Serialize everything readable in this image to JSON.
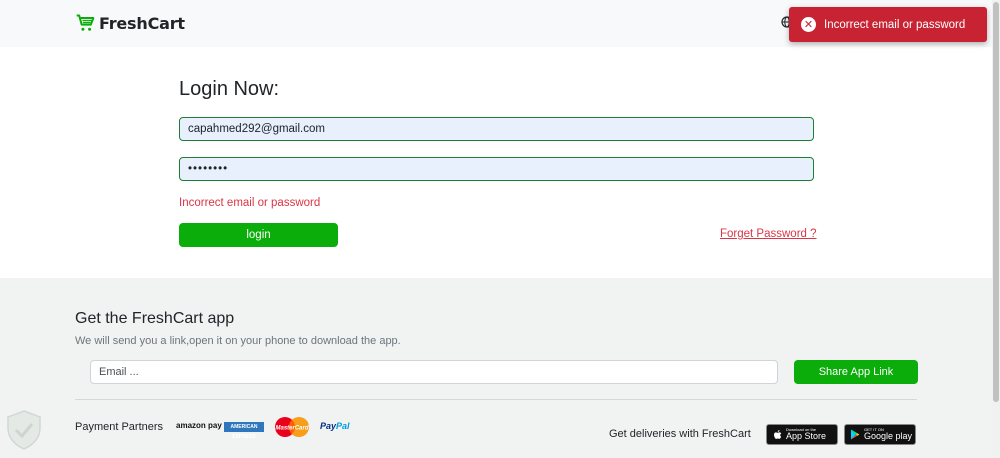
{
  "navbar": {
    "brand": "FreshCart",
    "brand_icon": "cart-icon",
    "language_icon": "globe-icon"
  },
  "toast": {
    "icon": "error-circle-icon",
    "icon_glyph": "✕",
    "message": "Incorrect email or password",
    "color": "#c82333"
  },
  "login": {
    "title": "Login Now:",
    "email_value": "capahmed292@gmail.com",
    "password_value": "••••••••",
    "error": "Incorrect email or password",
    "submit_label": "login",
    "forget_label": "Forget Password ?"
  },
  "footer": {
    "title": "Get the FreshCart app",
    "subtitle": "We will send you a link,open it on your phone to download the app.",
    "email_placeholder": "Email ...",
    "share_label": "Share App Link",
    "payment_label": "Payment Partners",
    "payment_partners": {
      "amazon": "amazon pay",
      "amex": "AMERICAN EXPRESS",
      "mastercard": "MasterCard",
      "paypal_pay": "Pay",
      "paypal_pal": "Pal"
    },
    "deliveries_label": "Get deliveries with FreshCart",
    "app_store": {
      "small": "Download on the",
      "big": "App Store"
    },
    "google_play": {
      "small": "GET IT ON",
      "big": "Google play"
    }
  },
  "colors": {
    "accent": "#0aad0a",
    "error": "#dc3545",
    "footer_bg": "#f0f3f2"
  }
}
